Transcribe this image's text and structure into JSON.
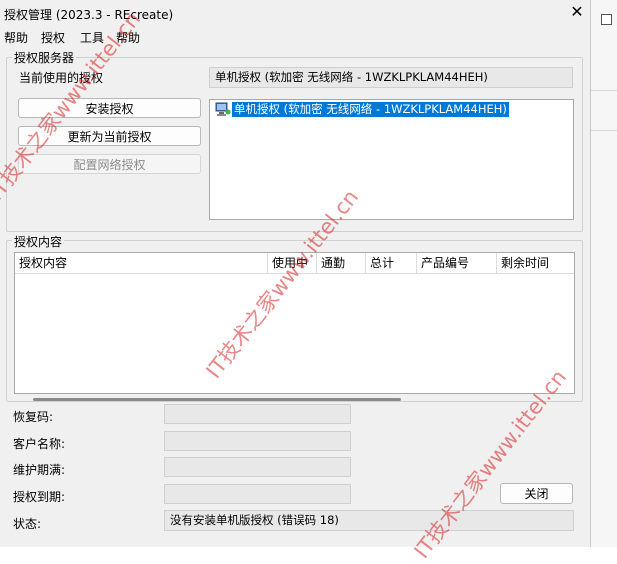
{
  "window": {
    "title": "授权管理 (2023.3 - REcreate)"
  },
  "menu": {
    "items": [
      "帮助",
      "授权",
      "工具",
      "帮助"
    ]
  },
  "server_group": {
    "title": "授权服务器",
    "current_label": "当前使用的授权",
    "current_value": "单机授权 (软加密 无线网络 - 1WZKLPKLAM44HEH)",
    "buttons": {
      "install": "安装授权",
      "update": "更新为当前授权",
      "configure": "配置网络授权"
    },
    "list_items": [
      "单机授权 (软加密 无线网络 - 1WZKLPKLAM44HEH)"
    ]
  },
  "content_group": {
    "title": "授权内容",
    "columns": [
      "授权内容",
      "使用中",
      "通勤",
      "总计",
      "产品编号",
      "剩余时间"
    ],
    "rows": []
  },
  "details": {
    "recovery_code_label": "恢复码:",
    "customer_name_label": "客户名称:",
    "maintenance_label": "维护期满:",
    "expiry_label": "授权到期:",
    "status_label": "状态:",
    "status_value": "没有安装单机版授权 (错误码 18)",
    "close_button": "关闭"
  },
  "watermark": {
    "text": "IT技术之家www.ittel.cn"
  }
}
